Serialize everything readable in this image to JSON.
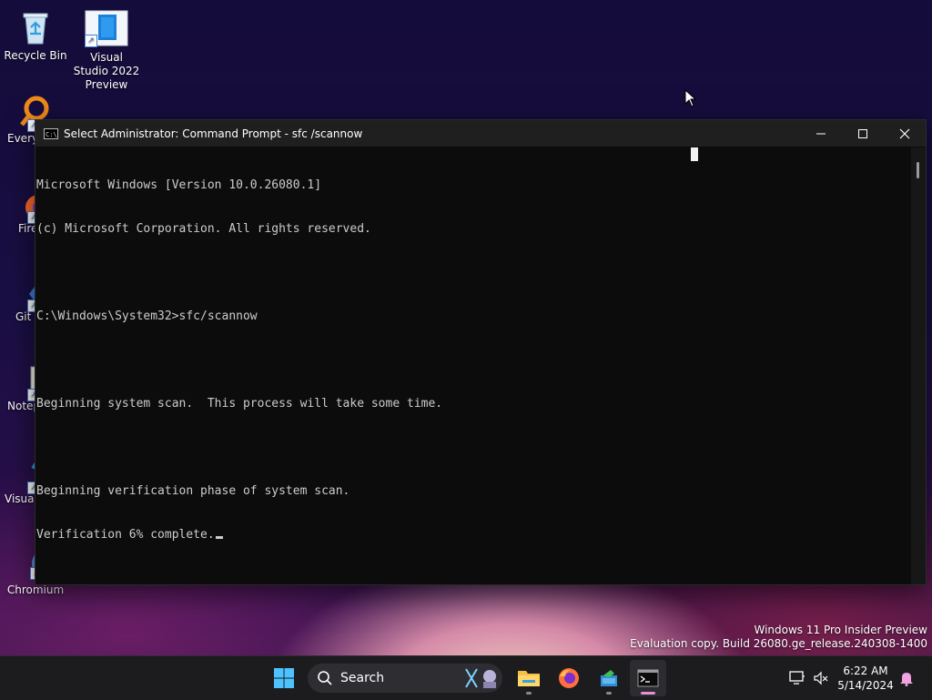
{
  "desktop": {
    "icons": [
      {
        "label": "Recycle Bin"
      },
      {
        "label": "Visual Studio 2022 Preview"
      },
      {
        "label": "Every"
      },
      {
        "label": "Fire"
      },
      {
        "label": "Git E"
      },
      {
        "label": "Notep"
      },
      {
        "label": "Visual Co"
      },
      {
        "label": "Chromium"
      }
    ]
  },
  "window": {
    "title": "Select Administrator: Command Prompt - sfc /scannow",
    "console_lines": [
      "Microsoft Windows [Version 10.0.26080.1]",
      "(c) Microsoft Corporation. All rights reserved.",
      "",
      "C:\\Windows\\System32>sfc/scannow",
      "",
      "Beginning system scan.  This process will take some time.",
      "",
      "Beginning verification phase of system scan.",
      "Verification 6% complete."
    ]
  },
  "watermark": {
    "line1": "Windows 11 Pro Insider Preview",
    "line2": "Evaluation copy. Build 26080.ge_release.240308-1400"
  },
  "taskbar": {
    "search_label": "Search",
    "time": "6:22 AM",
    "date": "5/14/2024"
  },
  "colors": {
    "console_bg": "#0c0c0c",
    "console_text": "#cccccc",
    "taskbar_bg": "#1c1c1f",
    "active_indicator": "#e590d8"
  }
}
